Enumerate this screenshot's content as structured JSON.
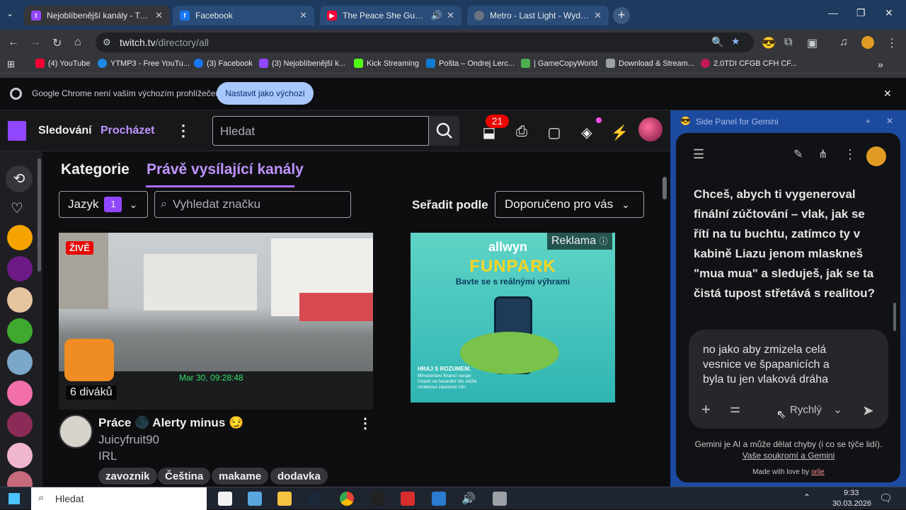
{
  "browser": {
    "tabs": [
      {
        "title": "Nejoblíbenější kanály - Twitch",
        "active": true
      },
      {
        "title": "Facebook",
        "active": false
      },
      {
        "title": "The Peace She Guards | Am",
        "active": false
      },
      {
        "title": "Metro - Last Light - Wydanie K",
        "active": false
      }
    ],
    "url_host": "twitch.tv",
    "url_path": "/directory/all",
    "bookmarks": [
      "(4) YouTube",
      "YTMP3 - Free YouTu...",
      "(3) Facebook",
      "(3) Nejoblíbenější k...",
      "Kick Streaming",
      "Pošta – Ondrej Lerc...",
      "| GameCopyWorld",
      "Download & Stream...",
      "2.0TDI CFGB CFH CF..."
    ],
    "default_bar": {
      "text": "Google Chrome není vaším výchozím prohlížečem",
      "button": "Nastavit jako výchozí"
    }
  },
  "twitch": {
    "nav": {
      "following": "Sledování",
      "browse": "Procházet",
      "search_placeholder": "Hledat",
      "notif_count": "21"
    },
    "tabs": {
      "categories": "Kategorie",
      "live": "Právě vysílající kanály"
    },
    "filters": {
      "language": "Jazyk",
      "language_count": "1",
      "tag_placeholder": "Vyhledat značku",
      "sort_label": "Seřadit podle",
      "sort_value": "Doporučeno pro vás"
    },
    "stream": {
      "live_badge": "ŽIVĚ",
      "viewers": "6 diváků",
      "timestamp": "Mar 30, 09:28:48",
      "title": "Práce 🌑 Alerty minus 😏",
      "channel": "Juicyfruit90",
      "category": "IRL",
      "tags": [
        "zavoznik",
        "Čeština",
        "makame",
        "dodavka"
      ]
    },
    "ad": {
      "label": "Reklama",
      "brand": "allwyn",
      "headline": "FUNPARK",
      "subline": "Bavte se s reálnými výhrami",
      "disclaimer_title": "HRAJ S ROZUMEM.",
      "disclaimer": "Ministerstvo financí varuje: Účastí na hazardní hře může vzniknout závislost! 18+"
    }
  },
  "gemini": {
    "header": "Side Panel for Gemini",
    "message": "Chceš, abych ti vygeneroval finální zúčtování – vlak, jak se řítí na tu buchtu, zatímco ty v kabině Liazu jenom mlaskneš \"mua mua\" a sleduješ, jak se ta čistá tupost střetává s realitou?",
    "input": "no jako aby zmizela celá vesnice ve špapanicích a byla tu jen vlaková dráha",
    "mode": "Rychlý",
    "footer": "Gemini je AI a může dělat chyby (i co se týče lidí).",
    "footer_link": "Vaše soukromí a Gemini",
    "made_with": "Made with love by",
    "made_with_link": "orlie"
  },
  "taskbar": {
    "search": "Hledat",
    "time": "9:33",
    "date": "30.03.2026"
  }
}
